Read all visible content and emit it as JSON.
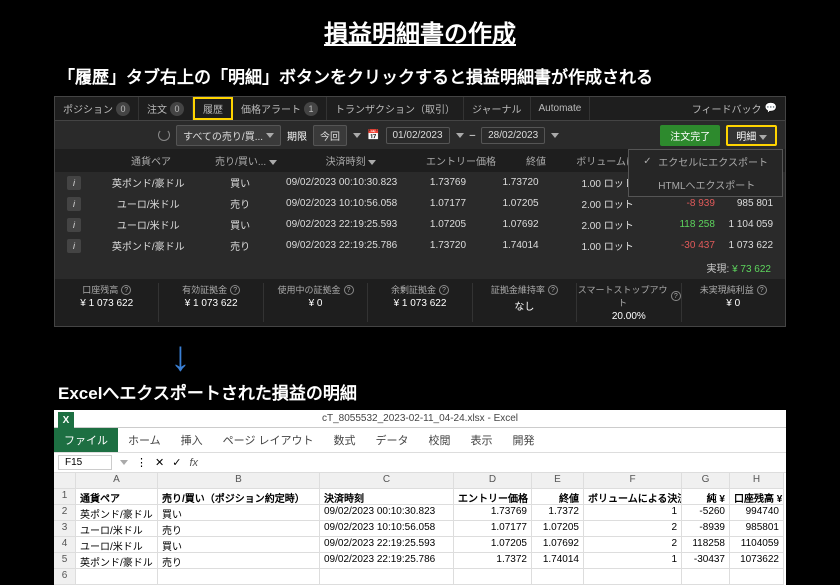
{
  "title": "損益明細書の作成",
  "subtitle": "「履歴」タブ右上の「明細」ボタンをクリックすると損益明細書が作成される",
  "tabs": {
    "position": "ポジション",
    "orders": "注文",
    "history": "履歴",
    "price_alert": "価格アラート",
    "transactions": "トランザクション（取引）",
    "journal": "ジャーナル",
    "automate": "Automate",
    "feedback": "フィードバック",
    "badge0": "0",
    "badge1": "1"
  },
  "filter": {
    "all": "すべての売り/買...",
    "period": "期限",
    "today": "今回",
    "from": "01/02/2023",
    "to": "28/02/2023",
    "order_done": "注文完了",
    "details": "明細"
  },
  "thead": {
    "pair": "通貨ペア",
    "bs": "売り/買い...",
    "time": "決済時刻",
    "entry": "エントリー価格",
    "close": "終値",
    "vol": "ボリュームによる決済"
  },
  "menu": {
    "excel": "エクセルにエクスポート",
    "html": "HTMLへエクスポート",
    "check": "✓"
  },
  "rows": [
    {
      "pair": "英ポンド/豪ドル",
      "bs": "買い",
      "time": "09/02/2023 00:10:30.823",
      "entry": "1.73769",
      "close": "1.73720",
      "vol": "1.00 ロット",
      "pl": "",
      "bal": ""
    },
    {
      "pair": "ユーロ/米ドル",
      "bs": "売り",
      "time": "09/02/2023 10:10:56.058",
      "entry": "1.07177",
      "close": "1.07205",
      "vol": "2.00 ロット",
      "pl": "-8 939",
      "pl_cls": "pl-neg",
      "bal": "985 801"
    },
    {
      "pair": "ユーロ/米ドル",
      "bs": "買い",
      "time": "09/02/2023 22:19:25.593",
      "entry": "1.07205",
      "close": "1.07692",
      "vol": "2.00 ロット",
      "pl": "118 258",
      "pl_cls": "pl-pos",
      "bal": "1 104 059"
    },
    {
      "pair": "英ポンド/豪ドル",
      "bs": "売り",
      "time": "09/02/2023 22:19:25.786",
      "entry": "1.73720",
      "close": "1.74014",
      "vol": "1.00 ロット",
      "pl": "-30 437",
      "pl_cls": "pl-neg",
      "bal": "1 073 622"
    }
  ],
  "realized": {
    "label": "実現: ",
    "value": "¥ 73 622"
  },
  "footer": [
    {
      "lbl": "口座残高",
      "val": "¥ 1 073 622"
    },
    {
      "lbl": "有効証拠金",
      "val": "¥ 1 073 622"
    },
    {
      "lbl": "使用中の証拠金",
      "val": "¥ 0"
    },
    {
      "lbl": "余剰証拠金",
      "val": "¥ 1 073 622"
    },
    {
      "lbl": "証拠金維持率",
      "val": "なし"
    },
    {
      "lbl": "スマートストップアウト",
      "val": "20.00%"
    },
    {
      "lbl": "未実現純利益",
      "val": "¥ 0"
    }
  ],
  "excel_title": "Excelへエクスポートされた損益の明細",
  "excel": {
    "titlebar": "cT_8055532_2023-02-11_04-24.xlsx - Excel",
    "ribbon": {
      "file": "ファイル",
      "home": "ホーム",
      "insert": "挿入",
      "layout": "ページ レイアウト",
      "formula": "数式",
      "data": "データ",
      "review": "校閲",
      "view": "表示",
      "dev": "開発"
    },
    "cellref": "F15",
    "fx": "fx",
    "cols": [
      "",
      "A",
      "B",
      "C",
      "D",
      "E",
      "F",
      "G",
      "H"
    ],
    "header": [
      "1",
      "通貨ペア",
      "売り/買い（ポジション約定時）",
      "決済時刻",
      "エントリー価格",
      "終値",
      "ボリュームによる決済?",
      "純 ¥",
      "口座残高 ¥"
    ],
    "rows": [
      [
        "2",
        "英ポンド/豪ドル",
        "買い",
        "09/02/2023 00:10:30.823",
        "1.73769",
        "1.7372",
        "1",
        "-5260",
        "994740"
      ],
      [
        "3",
        "ユーロ/米ドル",
        "売り",
        "09/02/2023 10:10:56.058",
        "1.07177",
        "1.07205",
        "2",
        "-8939",
        "985801"
      ],
      [
        "4",
        "ユーロ/米ドル",
        "買い",
        "09/02/2023 22:19:25.593",
        "1.07205",
        "1.07692",
        "2",
        "118258",
        "1104059"
      ],
      [
        "5",
        "英ポンド/豪ドル",
        "売り",
        "09/02/2023 22:19:25.786",
        "1.7372",
        "1.74014",
        "1",
        "-30437",
        "1073622"
      ]
    ],
    "empty": "6"
  }
}
